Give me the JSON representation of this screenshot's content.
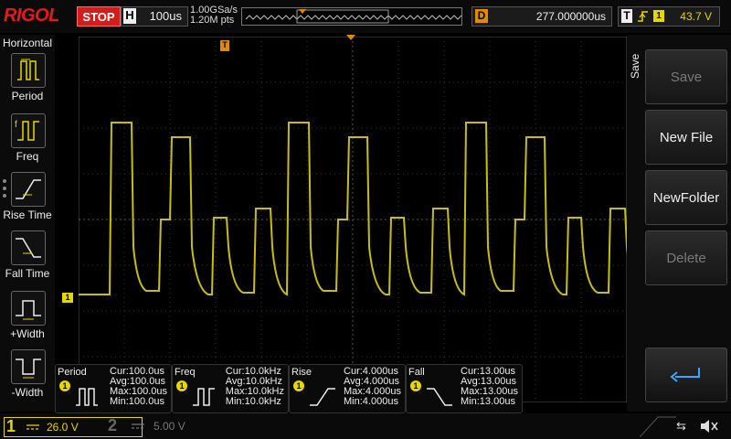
{
  "topbar": {
    "logo": "RIGOL",
    "run_status": "STOP",
    "timebase_key": "H",
    "timebase_value": "100us",
    "sample_rate": "1.00GSa/s",
    "memory_depth": "1.20M pts",
    "delay_key": "D",
    "delay_value": "277.000000us",
    "trigger_key": "T",
    "trigger_source": "1",
    "trigger_level": "43.7 V"
  },
  "left_menu": {
    "title": "Horizontal",
    "items": [
      {
        "label": "Period",
        "icon": "period-icon"
      },
      {
        "label": "Freq",
        "icon": "frequency-icon"
      },
      {
        "label": "Rise Time",
        "icon": "rise-time-icon"
      },
      {
        "label": "Fall Time",
        "icon": "fall-time-icon"
      },
      {
        "label": "+Width",
        "icon": "positive-width-icon"
      },
      {
        "label": "-Width",
        "icon": "negative-width-icon"
      }
    ]
  },
  "right_menu": {
    "tab": "Save",
    "buttons": [
      {
        "label": "Save",
        "enabled": false
      },
      {
        "label": "New File",
        "enabled": true
      },
      {
        "label": "NewFolder",
        "enabled": true
      },
      {
        "label": "Delete",
        "enabled": false
      },
      {
        "label": "",
        "icon": "return-arrow-icon",
        "enabled": true
      }
    ]
  },
  "measurements": [
    {
      "name": "Period",
      "channel": "1",
      "cur": "Cur:100.0us",
      "avg": "Avg:100.0us",
      "max": "Max:100.0us",
      "min": "Min:100.0us"
    },
    {
      "name": "Freq",
      "channel": "1",
      "cur": "Cur:10.0kHz",
      "avg": "Avg:10.0kHz",
      "max": "Max:10.0kHz",
      "min": "Min:10.0kHz"
    },
    {
      "name": "Rise",
      "channel": "1",
      "cur": "Cur:4.000us",
      "avg": "Avg:4.000us",
      "max": "Max:4.000us",
      "min": "Min:4.000us"
    },
    {
      "name": "Fall",
      "channel": "1",
      "cur": "Cur:13.00us",
      "avg": "Avg:13.00us",
      "max": "Max:13.00us",
      "min": "Min:13.00us"
    }
  ],
  "channels": {
    "ch1_number": "1",
    "ch1_scale": "26.0 V",
    "ch2_number": "2",
    "ch2_scale": "5.00 V"
  },
  "markers": {
    "trigger_marker": "T",
    "channel_marker": "1"
  },
  "colors": {
    "ch1": "#e5d800",
    "stop": "#d31c1c",
    "accent": "#e08a00"
  }
}
